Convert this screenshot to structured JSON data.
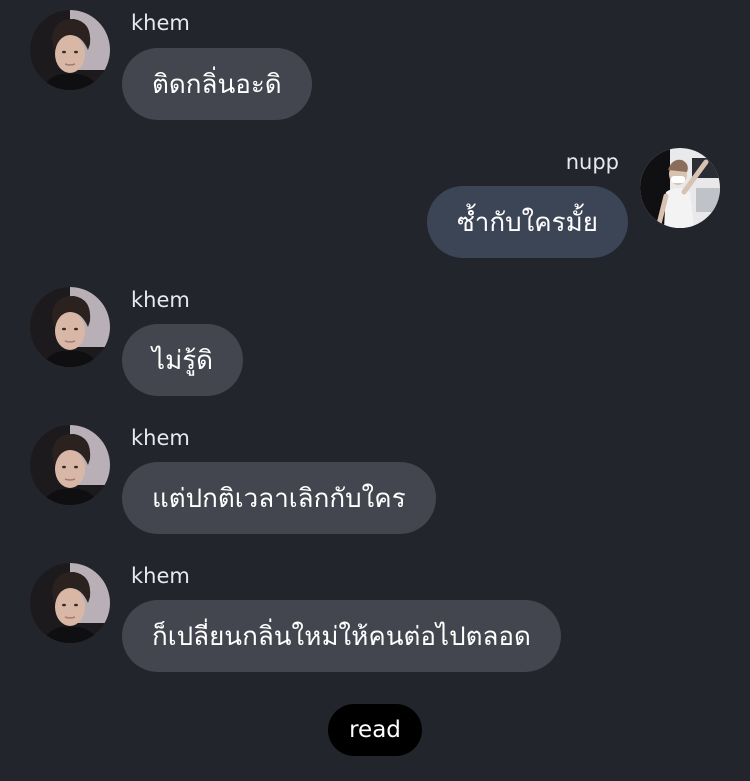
{
  "messages": [
    {
      "sender": "khem",
      "text": "ติดกลิ่นอะดิ",
      "direction": "incoming"
    },
    {
      "sender": "nupp",
      "text": "ซ้ำกับใครมั้ย",
      "direction": "outgoing"
    },
    {
      "sender": "khem",
      "text": "ไม่รู้ดิ",
      "direction": "incoming"
    },
    {
      "sender": "khem",
      "text": "แต่ปกติเวลาเลิกกับใคร",
      "direction": "incoming"
    },
    {
      "sender": "khem",
      "text": "ก็เปลี่ยนกลิ่นใหม่ให้คนต่อไปตลอด",
      "direction": "incoming"
    }
  ],
  "status": {
    "read_label": "read"
  },
  "colors": {
    "background": "#23252c",
    "incoming_bubble": "#43464e",
    "outgoing_bubble": "#3c4556",
    "read_pill": "#000000"
  }
}
